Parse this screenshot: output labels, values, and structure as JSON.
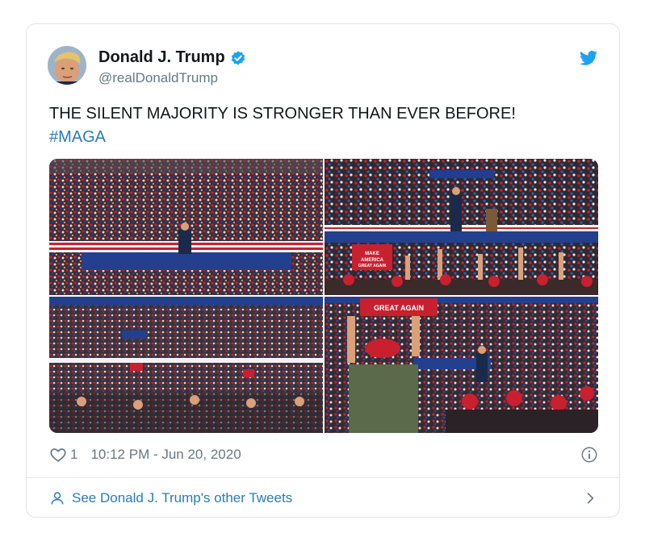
{
  "author": {
    "display_name": "Donald J. Trump",
    "handle": "@realDonaldTrump",
    "verified": true
  },
  "tweet": {
    "text": "THE SILENT MAJORITY IS STRONGER THAN EVER BEFORE!",
    "hashtag": "#MAGA"
  },
  "media": {
    "photos": [
      {
        "sign_text": ""
      },
      {
        "sign_text": "MAKE AMERICA GREAT AGAIN"
      },
      {
        "sign_text": ""
      },
      {
        "sign_text": "GREAT AGAIN"
      }
    ]
  },
  "meta": {
    "like_count": "1",
    "timestamp": "10:12 PM - Jun 20, 2020"
  },
  "footer": {
    "link_text": "See Donald J. Trump's other Tweets"
  },
  "colors": {
    "link": "#2b7bb9",
    "verified": "#1da1f2",
    "muted": "#697882",
    "crowd_red": "#c8202f",
    "crowd_blue": "#23408e"
  },
  "icons": {
    "brand": "twitter-bird-icon",
    "verified": "verified-badge-icon",
    "like": "heart-icon",
    "info": "info-icon",
    "profile": "person-icon",
    "more": "chevron-right-icon"
  }
}
